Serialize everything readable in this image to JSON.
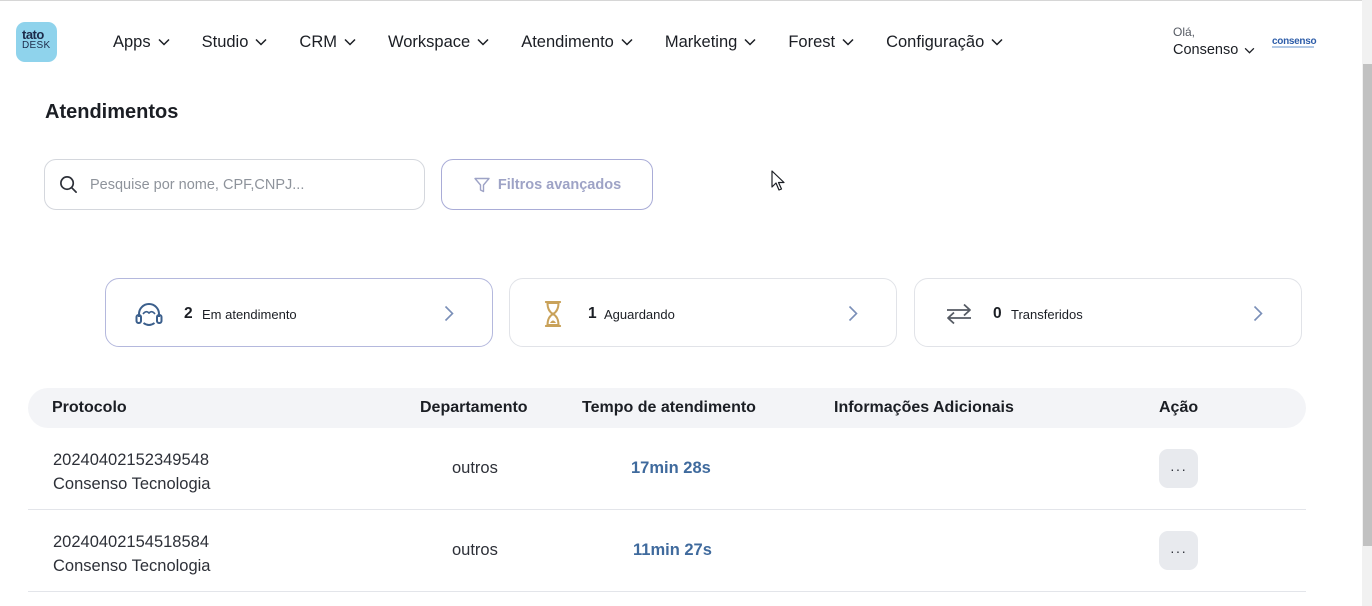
{
  "logo": {
    "line1": "tato",
    "line2": "DESK"
  },
  "nav": {
    "items": [
      {
        "label": "Apps"
      },
      {
        "label": "Studio"
      },
      {
        "label": "CRM"
      },
      {
        "label": "Workspace"
      },
      {
        "label": "Atendimento"
      },
      {
        "label": "Marketing"
      },
      {
        "label": "Forest"
      },
      {
        "label": "Configuração"
      }
    ]
  },
  "user": {
    "greeting": "Olá,",
    "name": "Consenso",
    "brand": "consenso"
  },
  "page": {
    "title": "Atendimentos"
  },
  "search": {
    "placeholder": "Pesquise por nome, CPF,CNPJ..."
  },
  "filter": {
    "label": "Filtros avançados"
  },
  "cards": [
    {
      "count": "2",
      "label": "Em atendimento",
      "icon": "headset-icon"
    },
    {
      "count": "1",
      "label": "Aguardando",
      "icon": "hourglass-icon"
    },
    {
      "count": "0",
      "label": "Transferidos",
      "icon": "transfer-icon"
    }
  ],
  "table": {
    "headers": {
      "protocolo": "Protocolo",
      "departamento": "Departamento",
      "tempo": "Tempo de atendimento",
      "info": "Informações Adicionais",
      "acao": "Ação"
    },
    "rows": [
      {
        "protocol": "20240402152349548",
        "company": "Consenso Tecnologia",
        "department": "outros",
        "time": "17min 28s",
        "action": "···"
      },
      {
        "protocol": "20240402154518584",
        "company": "Consenso Tecnologia",
        "department": "outros",
        "time": "11min 27s",
        "action": "···"
      }
    ]
  },
  "colors": {
    "accent_border": "#b4b8dd",
    "time_text": "#3f6a9d",
    "hourglass": "#c9a25a",
    "icon_blue": "#3b5f8c"
  }
}
